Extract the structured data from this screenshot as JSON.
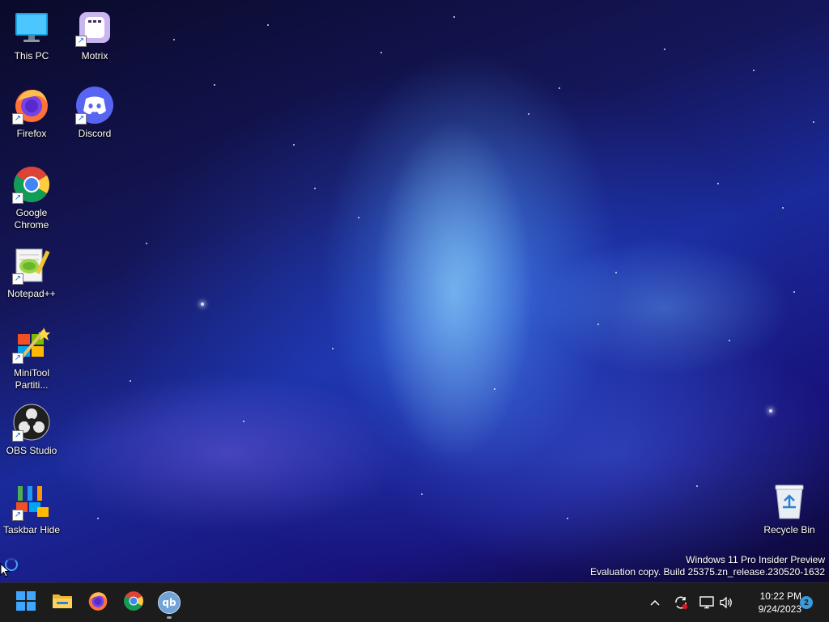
{
  "desktop_icons": [
    {
      "name": "this-pc",
      "label": "This PC",
      "shortcut": false
    },
    {
      "name": "motrix",
      "label": "Motrix",
      "shortcut": true
    },
    {
      "name": "firefox",
      "label": "Firefox",
      "shortcut": true
    },
    {
      "name": "discord",
      "label": "Discord",
      "shortcut": true
    },
    {
      "name": "google-chrome",
      "label": "Google Chrome",
      "shortcut": true
    },
    {
      "name": "notepad-plus-plus",
      "label": "Notepad++",
      "shortcut": true
    },
    {
      "name": "minitool-partition",
      "label": "MiniTool Partiti...",
      "shortcut": true
    },
    {
      "name": "obs-studio",
      "label": "OBS Studio",
      "shortcut": true
    },
    {
      "name": "taskbar-hide",
      "label": "Taskbar Hide",
      "shortcut": true
    },
    {
      "name": "recycle-bin",
      "label": "Recycle Bin",
      "shortcut": false
    }
  ],
  "watermark": {
    "line1": "Windows 11 Pro Insider Preview",
    "line2": "Evaluation copy. Build 25375.zn_release.230520-1632"
  },
  "taskbar": {
    "apps": [
      {
        "name": "start",
        "icon": "windows-logo-icon"
      },
      {
        "name": "file-explorer",
        "icon": "folder-icon"
      },
      {
        "name": "firefox",
        "icon": "firefox-icon"
      },
      {
        "name": "chrome",
        "icon": "chrome-icon"
      },
      {
        "name": "qbittorrent",
        "icon": "qbittorrent-icon",
        "label": "qb",
        "running": true
      }
    ],
    "tray": {
      "chevron": "^",
      "time": "10:22 PM",
      "date": "9/24/2023",
      "notification_count": "2"
    }
  },
  "colors": {
    "taskbar_bg": "#1c1c1c",
    "accent": "#3a9bdc",
    "desktop_deep": "#15165a"
  }
}
